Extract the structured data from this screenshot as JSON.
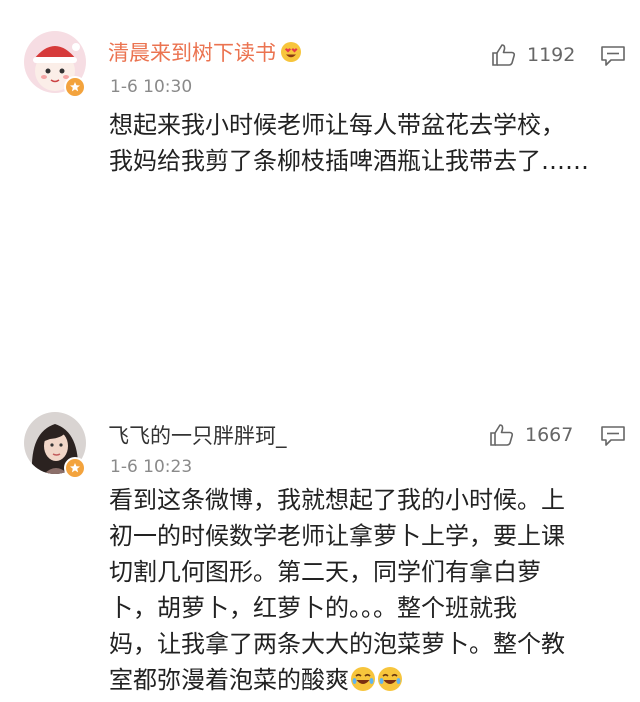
{
  "comments": [
    {
      "username": "清晨来到树下读书",
      "timestamp": "1-6 10:30",
      "likes": "1192",
      "text_lines": [
        "想起来我小时候老师让每人带盆花去学校，",
        "我妈给我剪了条柳枝插啤酒瓶让我带去了……"
      ],
      "username_color": "#eb7350",
      "username_emoji": "heart-eyes-emoji"
    },
    {
      "username": "飞飞的一只胖胖珂_",
      "timestamp": "1-6 10:23",
      "likes": "1667",
      "text_lines": [
        "看到这条微博，我就想起了我的小时候。上",
        "初一的时候数学老师让拿萝卜上学，要上课",
        "切割几何图形。第二天，同学们有拿白萝",
        "卜，胡萝卜，红萝卜的。。。整个班就我",
        "妈，让我拿了两条大大的泡菜萝卜。整个教",
        "室都弥漫着泡菜的酸爽"
      ],
      "text_end_emojis": [
        "laugh-cry-emoji",
        "laugh-cry-emoji"
      ],
      "username_color": "#333333"
    }
  ],
  "colors": {
    "vip_badge": "#f3a33d",
    "timestamp": "#8a8a8a",
    "icon": "#666666"
  }
}
